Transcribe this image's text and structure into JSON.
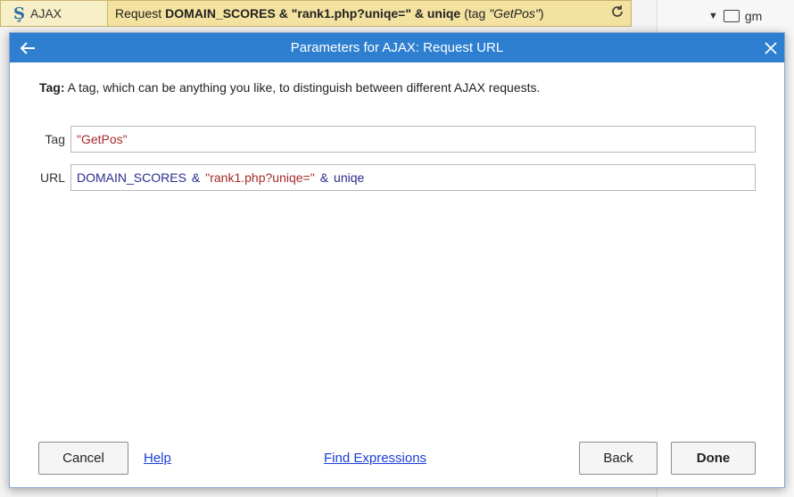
{
  "background": {
    "object_name": "AJAX",
    "action": {
      "prefix": "Request",
      "expr_bold": "DOMAIN_SCORES & \"rank1.php?uniqe=\" & uniqe",
      "tag_open": "(tag",
      "tag_value": "\"GetPos\"",
      "tag_close": ")"
    },
    "tree_item": "gm"
  },
  "dialog": {
    "title": "Parameters for AJAX: Request URL",
    "help": {
      "param": "Tag:",
      "description": "A tag, which can be anything you like, to distinguish between different AJAX requests."
    },
    "params": [
      {
        "label": "Tag",
        "tokens": [
          {
            "t": "\"GetPos\"",
            "k": "str"
          }
        ]
      },
      {
        "label": "URL",
        "tokens": [
          {
            "t": "DOMAIN_SCORES",
            "k": "id"
          },
          {
            "t": "&",
            "k": "op"
          },
          {
            "t": "\"rank1.php?uniqe=\"",
            "k": "str"
          },
          {
            "t": "&",
            "k": "op"
          },
          {
            "t": "uniqe",
            "k": "id"
          }
        ]
      }
    ],
    "buttons": {
      "cancel": "Cancel",
      "help": "Help",
      "find_expressions": "Find Expressions",
      "back": "Back",
      "done": "Done"
    }
  },
  "colors": {
    "titlebar": "#2e7fd0",
    "string": "#a52a2a",
    "identifier": "#2b2b8f",
    "link": "#1a3fd6"
  },
  "icons": [
    "ajax-icon",
    "refresh-icon",
    "folder-icon",
    "back-arrow-icon",
    "close-icon"
  ]
}
